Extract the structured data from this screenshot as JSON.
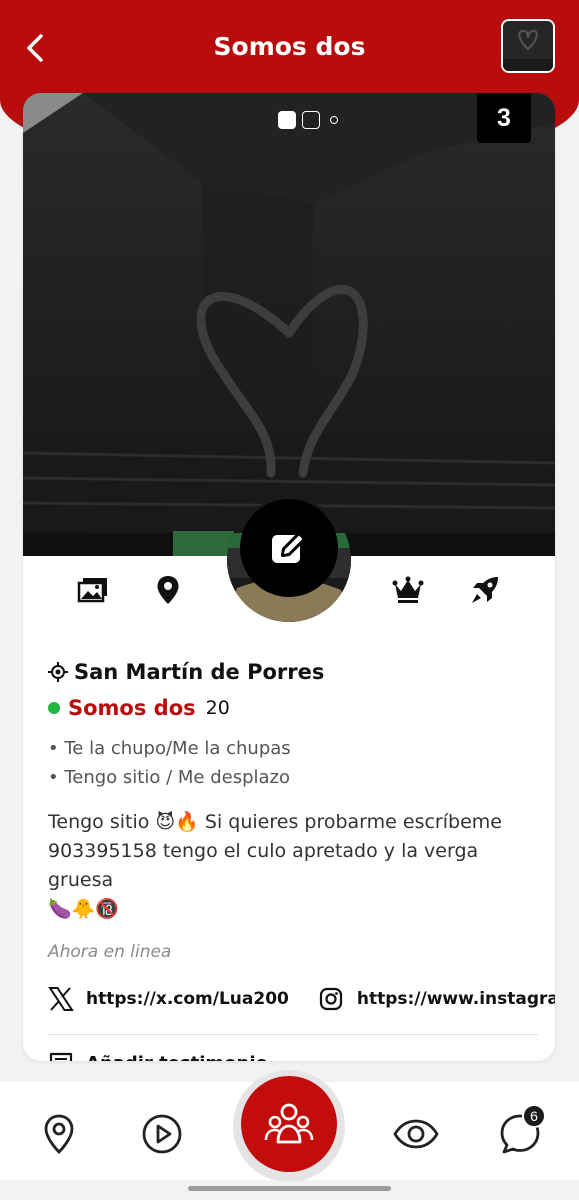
{
  "header": {
    "title": "Somos dos",
    "back_icon": "chevron-left-icon",
    "background_color": "#b90c0c"
  },
  "gallery": {
    "photo_count": "3",
    "indicator_count": 3,
    "active_index": 0
  },
  "profile_tabs": [
    {
      "icon": "photos-icon"
    },
    {
      "icon": "location-pin-icon"
    },
    {
      "icon": "crown-icon"
    },
    {
      "icon": "rocket-icon"
    }
  ],
  "profile": {
    "location": "San Martín de Porres",
    "name": "Somos dos",
    "age": "20",
    "online_color": "#1fb83f",
    "preferences": [
      "• Te la chupo/Me la chupas",
      "• Tengo sitio / Me desplazo"
    ],
    "description_line1": "Tengo sitio 😈🔥 Si quieres probarme escríbeme",
    "description_line2": "903395158 tengo el culo apretado y la verga gruesa",
    "description_line3": "🍆🐥🔞",
    "status": "Ahora en linea",
    "x_link": "https://x.com/Lua200",
    "instagram_link": "https://www.instagra",
    "add_testimonial": "Añadir testimonio"
  },
  "bottom_nav": {
    "items": [
      "location-pin-icon",
      "play-circle-icon",
      "community-icon",
      "eye-icon",
      "chat-bubble-icon"
    ],
    "chat_badge": "6",
    "accent": "#c30d0d"
  }
}
